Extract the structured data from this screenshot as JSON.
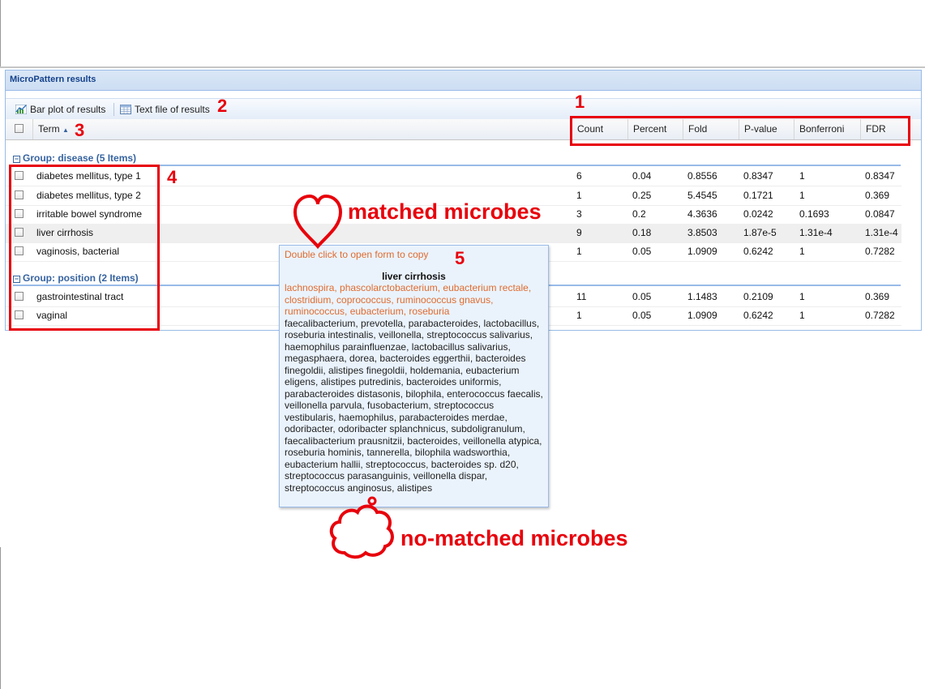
{
  "panel": {
    "title": "MicroPattern results"
  },
  "toolbar": {
    "barplot_label": "Bar plot of results",
    "textfile_label": "Text file of results"
  },
  "columns": {
    "term": "Term",
    "count": "Count",
    "percent": "Percent",
    "fold": "Fold",
    "pvalue": "P-value",
    "bonferroni": "Bonferroni",
    "fdr": "FDR"
  },
  "groups": [
    {
      "label": "Group: disease (5 Items)",
      "rows": [
        {
          "term": "diabetes mellitus, type 1",
          "count": "6",
          "percent": "0.04",
          "fold": "0.8556",
          "pvalue": "0.8347",
          "bonferroni": "1",
          "fdr": "0.8347"
        },
        {
          "term": "diabetes mellitus, type 2",
          "count": "1",
          "percent": "0.25",
          "fold": "5.4545",
          "pvalue": "0.1721",
          "bonferroni": "1",
          "fdr": "0.369"
        },
        {
          "term": "irritable bowel syndrome",
          "count": "3",
          "percent": "0.2",
          "fold": "4.3636",
          "pvalue": "0.0242",
          "bonferroni": "0.1693",
          "fdr": "0.0847"
        },
        {
          "term": "liver cirrhosis",
          "count": "9",
          "percent": "0.18",
          "fold": "3.8503",
          "pvalue": "1.87e-5",
          "bonferroni": "1.31e-4",
          "fdr": "1.31e-4"
        },
        {
          "term": "vaginosis, bacterial",
          "count": "1",
          "percent": "0.05",
          "fold": "1.0909",
          "pvalue": "0.6242",
          "bonferroni": "1",
          "fdr": "0.7282"
        }
      ]
    },
    {
      "label": "Group: position (2 Items)",
      "rows": [
        {
          "term": "gastrointestinal tract",
          "count": "11",
          "percent": "0.05",
          "fold": "1.1483",
          "pvalue": "0.2109",
          "bonferroni": "1",
          "fdr": "0.369"
        },
        {
          "term": "vaginal",
          "count": "1",
          "percent": "0.05",
          "fold": "1.0909",
          "pvalue": "0.6242",
          "bonferroni": "1",
          "fdr": "0.7282"
        }
      ]
    }
  ],
  "tooltip": {
    "hint": "Double click to open form to copy",
    "title": "liver cirrhosis",
    "matched": "lachnospira, phascolarctobacterium, eubacterium rectale, clostridium, coprococcus, ruminococcus gnavus, ruminococcus, eubacterium, roseburia",
    "unmatched": "faecalibacterium, prevotella, parabacteroides, lactobacillus, roseburia intestinalis, veillonella, streptococcus salivarius, haemophilus parainfluenzae, lactobacillus salivarius, megasphaera, dorea, bacteroides eggerthii, bacteroides finegoldii, alistipes finegoldii, holdemania, eubacterium eligens, alistipes putredinis, bacteroides uniformis, parabacteroides distasonis, bilophila, enterococcus faecalis, veillonella parvula, fusobacterium, streptococcus vestibularis, haemophilus, parabacteroides merdae, odoribacter, odoribacter splanchnicus, subdoligranulum, faecalibacterium prausnitzii, bacteroides, veillonella atypica, roseburia hominis, tannerella, bilophila wadsworthia, eubacterium hallii, streptococcus, bacteroides sp. d20, streptococcus parasanguinis, veillonella dispar, streptococcus anginosus, alistipes"
  },
  "annotations": {
    "n1": "1",
    "n2": "2",
    "n3": "3",
    "n4": "4",
    "n5": "5",
    "matched": "matched microbes",
    "unmatched": "no-matched microbes"
  },
  "colors": {
    "annotation_red": "#e8000b",
    "header_blue": "#15428b",
    "matched_orange": "#e06b2f"
  }
}
